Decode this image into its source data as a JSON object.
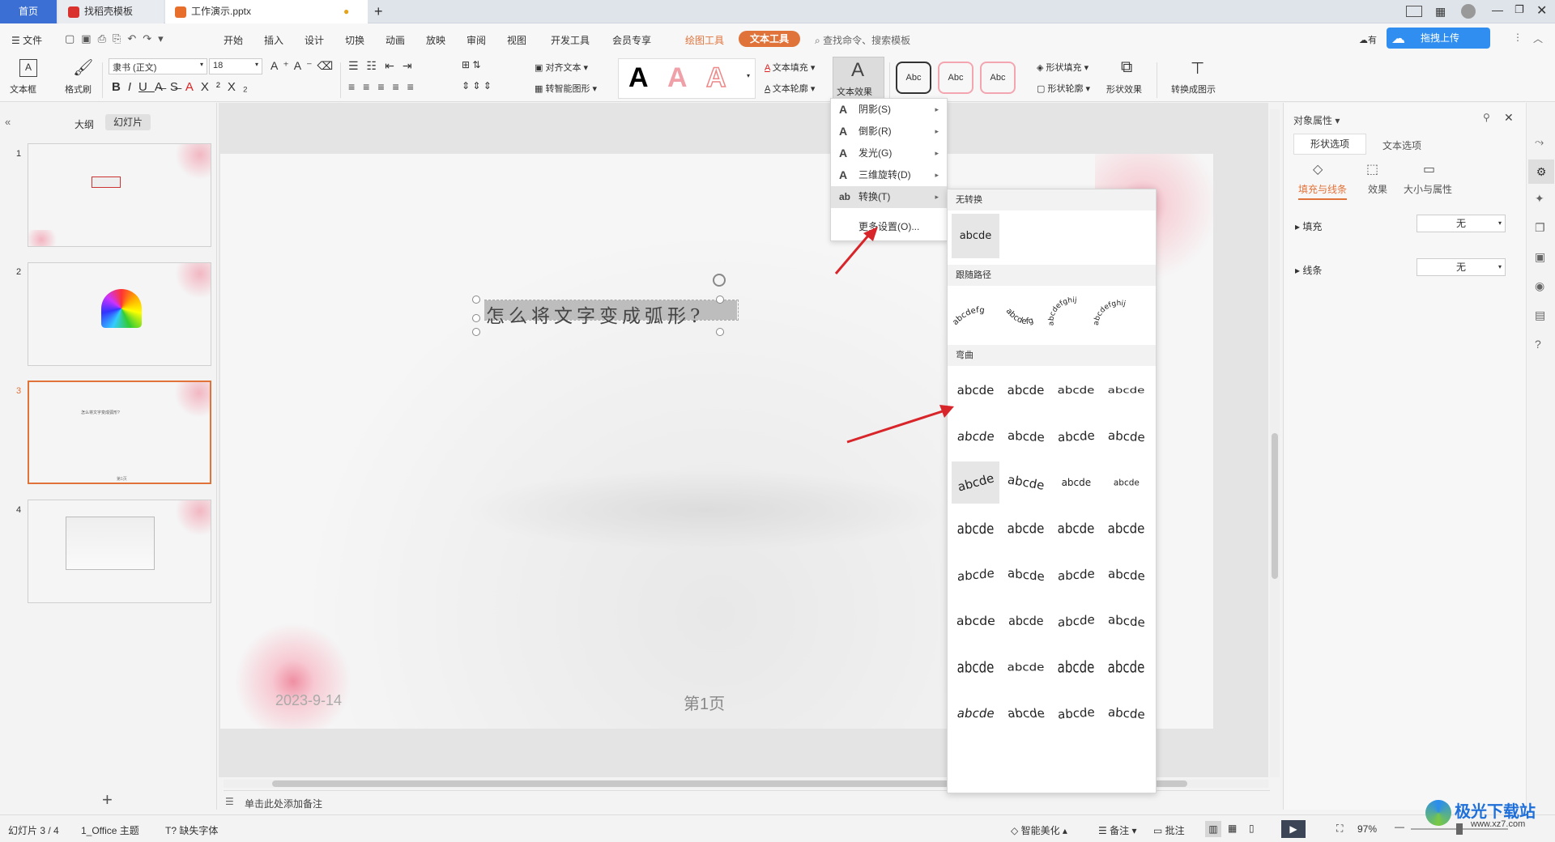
{
  "tabs": {
    "home": "首页",
    "template": "找稻壳模板",
    "doc": "工作演示.pptx",
    "add": "+"
  },
  "menu": {
    "file": "文件",
    "items": [
      "开始",
      "插入",
      "设计",
      "切换",
      "动画",
      "放映",
      "审阅",
      "视图",
      "开发工具",
      "会员专享"
    ],
    "drawing_tools": "绘图工具",
    "text_tools": "文本工具",
    "search": "查找命令、搜索模板",
    "upload": "拖拽上传",
    "have": "有"
  },
  "ribbon": {
    "textbox": "文本框",
    "format_painter": "格式刷",
    "font": "隶书 (正文)",
    "size": "18",
    "align_text": "对齐文本",
    "smart_shape": "转智能图形",
    "text_fill": "文本填充",
    "text_outline": "文本轮廓",
    "text_effect": "文本效果",
    "style_sample": "Abc",
    "shape_fill": "形状填充",
    "shape_outline": "形状轮廓",
    "shape_effect": "形状效果",
    "convert_diagram": "转换成图示"
  },
  "leftpane": {
    "outline": "大纲",
    "slides": "幻灯片",
    "thumb_nums": [
      "1",
      "2",
      "3",
      "4"
    ],
    "thumb_text3": "怎么将文字变成弧形?",
    "thumb_page": "第1页"
  },
  "slide": {
    "title": "怎么将文字变成弧形?",
    "date": "2023-9-14",
    "page": "第1页"
  },
  "notes": "单击此处添加备注",
  "fxmenu": {
    "items": [
      {
        "glyph": "A",
        "label": "阴影(S)"
      },
      {
        "glyph": "A",
        "label": "倒影(R)"
      },
      {
        "glyph": "A",
        "label": "发光(G)"
      },
      {
        "glyph": "A",
        "label": "三维旋转(D)"
      },
      {
        "glyph": "ab",
        "label": "转换(T)"
      }
    ],
    "more": "更多设置(O)..."
  },
  "submenu": {
    "no_transform": "无转换",
    "follow_path": "跟随路径",
    "warp": "弯曲",
    "sample": "abcde",
    "path_samples": [
      "abcdefg",
      "abcdefg",
      "abcdefghij",
      "abcdefghij"
    ],
    "warp_rows": 8
  },
  "rightpane": {
    "title": "对象属性",
    "tab_shape": "形状选项",
    "tab_text": "文本选项",
    "sub_fill": "填充与线条",
    "sub_effect": "效果",
    "sub_size": "大小与属性",
    "fill_label": "填充",
    "fill_value": "无",
    "line_label": "线条",
    "line_value": "无"
  },
  "status": {
    "slide_count": "幻灯片 3 / 4",
    "theme": "1_Office 主题",
    "missing_font": "缺失字体",
    "smart_beautify": "智能美化",
    "notes": "备注",
    "comment": "批注",
    "zoom": "97%"
  },
  "watermark": {
    "name": "极光下载站",
    "url": "www.xz7.com"
  },
  "colors": {
    "accent_blue": "#3b6fd4",
    "accent_orange": "#e0733a",
    "arrow_red": "#d8252a"
  }
}
